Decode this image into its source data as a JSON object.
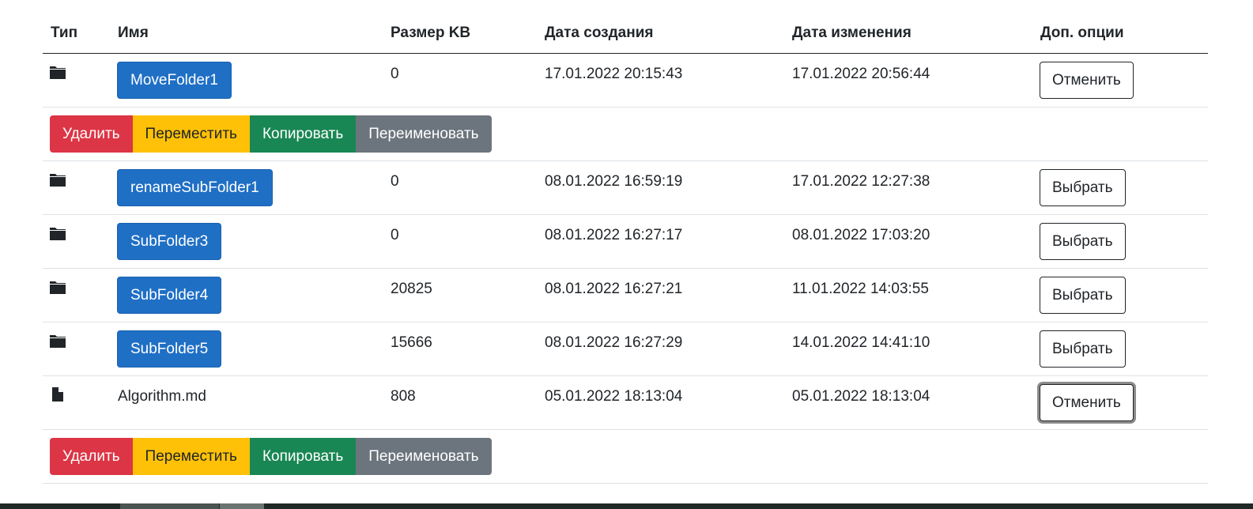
{
  "headers": {
    "type": "Тип",
    "name": "Имя",
    "size": "Размер KB",
    "created": "Дата создания",
    "modified": "Дата изменения",
    "options": "Доп. опции"
  },
  "actions": {
    "delete": "Удалить",
    "move": "Переместить",
    "copy": "Копировать",
    "rename": "Переименовать"
  },
  "rows": [
    {
      "kind": "folder",
      "icon": "folder-icon",
      "name": "MoveFolder1",
      "size": "0",
      "created": "17.01.2022 20:15:43",
      "modified": "17.01.2022 20:56:44",
      "option": "Отменить"
    },
    {
      "kind": "folder",
      "icon": "folder-icon",
      "name": "renameSubFolder1",
      "size": "0",
      "created": "08.01.2022 16:59:19",
      "modified": "17.01.2022 12:27:38",
      "option": "Выбрать"
    },
    {
      "kind": "folder",
      "icon": "folder-icon",
      "name": "SubFolder3",
      "size": "0",
      "created": "08.01.2022 16:27:17",
      "modified": "08.01.2022 17:03:20",
      "option": "Выбрать"
    },
    {
      "kind": "folder",
      "icon": "folder-icon",
      "name": "SubFolder4",
      "size": "20825",
      "created": "08.01.2022 16:27:21",
      "modified": "11.01.2022 14:03:55",
      "option": "Выбрать"
    },
    {
      "kind": "folder",
      "icon": "folder-icon",
      "name": "SubFolder5",
      "size": "15666",
      "created": "08.01.2022 16:27:29",
      "modified": "14.01.2022 14:41:10",
      "option": "Выбрать"
    },
    {
      "kind": "file",
      "icon": "file-icon",
      "name": "Algorithm.md",
      "size": "808",
      "created": "05.01.2022 18:13:04",
      "modified": "05.01.2022 18:13:04",
      "option": "Отменить"
    }
  ],
  "colors": {
    "primary": "#1f6fc5",
    "danger": "#dc3545",
    "warning": "#ffc107",
    "success": "#198754",
    "secondary": "#6c757d"
  }
}
